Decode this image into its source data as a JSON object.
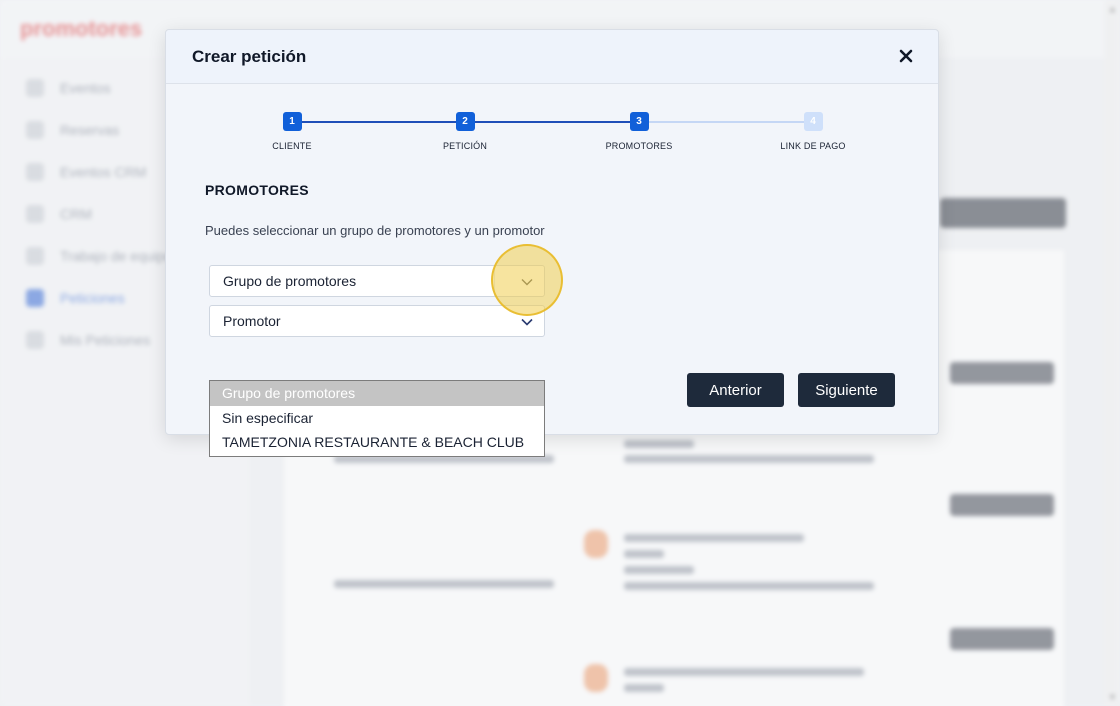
{
  "modal": {
    "title": "Crear petición",
    "close_symbol": "✕",
    "steps": [
      {
        "number": "1",
        "label": "CLIENTE",
        "state": "done"
      },
      {
        "number": "2",
        "label": "PETICIÓN",
        "state": "done"
      },
      {
        "number": "3",
        "label": "PROMOTORES",
        "state": "active"
      },
      {
        "number": "4",
        "label": "LINK DE PAGO",
        "state": "todo"
      }
    ],
    "section_title": "PROMOTORES",
    "section_description": "Puedes seleccionar un grupo de promotores y un promotor",
    "group_select": {
      "value": "Grupo de promotores",
      "icon": "chevron-down-icon"
    },
    "promoter_select": {
      "value": "Promotor",
      "icon": "chevron-down-icon"
    },
    "previous_button": "Anterior",
    "next_button": "Siguiente"
  },
  "dropdown": {
    "options": [
      {
        "label": "Grupo de promotores",
        "selected": true
      },
      {
        "label": "Sin especificar",
        "selected": false
      },
      {
        "label": "TAMETZONIA RESTAURANTE & BEACH CLUB",
        "selected": false
      }
    ]
  },
  "background_app": {
    "logo": "promotores",
    "sidebar_items": [
      "Eventos",
      "Reservas",
      "Eventos CRM",
      "CRM",
      "Trabajo de equipo",
      "Peticiones",
      "Mis Peticiones"
    ],
    "active_sidebar_index": 5
  },
  "colors": {
    "step_done": "#1160d9",
    "step_todo": "#cfe0fa",
    "button_dark": "#1e2a3b",
    "highlight": "#f0cd50"
  }
}
